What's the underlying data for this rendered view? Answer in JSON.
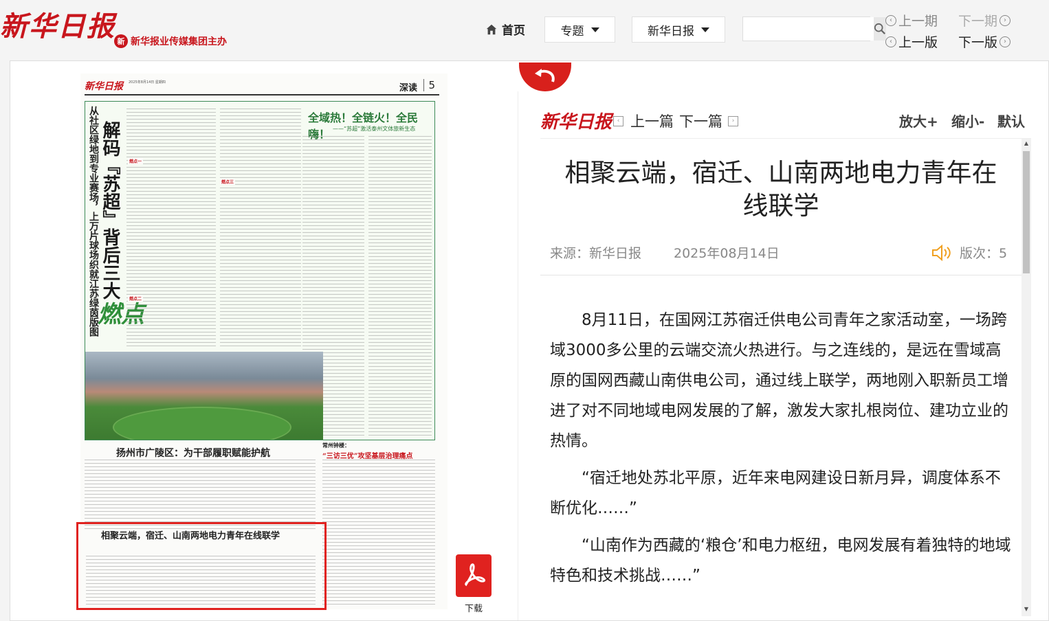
{
  "header": {
    "logo_text": "新华日报",
    "group_mark": "新",
    "group_text": "新华报业传媒集团主办",
    "home_label": "首页",
    "topics_label": "专题",
    "paper_label": "新华日报",
    "search_placeholder": "",
    "prev_issue": "上一期",
    "next_issue": "下一期",
    "prev_page": "上一版",
    "next_page": "下一版"
  },
  "newspaper": {
    "logo": "新华日报",
    "date_line": "2025年8月14日 星期四",
    "section": "深读",
    "page_number": "5",
    "green_vertical_small": "从社区绿地到专业赛场，上万片球场织就江苏绿茵版图",
    "green_vertical_big": "解码『苏超』背后三大",
    "green_burst": "燃点",
    "green_headline": "全域热！全链火！全民嗨！",
    "green_sub": "——“苏超”激活泰州文体旅新生态",
    "subhead_1": "燃点一",
    "subhead_2": "燃点二",
    "subhead_3": "燃点三",
    "headline_guangling": "扬州市广陵区：为干部履职赋能护航",
    "kicker_changzhou": "常州钟楼：",
    "headline_changzhou": "“三访三优”攻坚基层治理痛点",
    "selected_title": "相聚云端，宿迁、山南两地电力青年在线联学"
  },
  "download_label": "下载",
  "panel": {
    "logo": "新华日报",
    "prev_article": "上一篇",
    "next_article": "下一篇",
    "zoom_in": "放大+",
    "zoom_out": "缩小-",
    "zoom_default": "默认",
    "title": "相聚云端，宿迁、山南两地电力青年在线联学",
    "source": "来源：新华日报",
    "date": "2025年08月14日",
    "page_label": "版次：5",
    "paragraphs": [
      "8月11日，在国网江苏宿迁供电公司青年之家活动室，一场跨域3000多公里的云端交流火热进行。与之连线的，是远在雪域高原的国网西藏山南供电公司，通过线上联学，两地刚入职新员工增进了对不同地域电网发展的了解，激发大家扎根岗位、建功立业的热情。",
      "“宿迁地处苏北平原，近年来电网建设日新月异，调度体系不断优化……”",
      "“山南作为西藏的‘粮仓’和电力枢纽，电网发展有着独特的地域特色和技术挑战……”"
    ]
  },
  "colors": {
    "brand_red": "#c8161d",
    "highlight_red": "#e0221f",
    "green_accent": "#2b7a3a"
  },
  "icons": [
    "home-icon",
    "caret-down-icon",
    "search-icon",
    "circle-left-icon",
    "circle-right-icon",
    "back-arrow-icon",
    "pdf-icon",
    "square-left-icon",
    "square-right-icon",
    "speaker-icon"
  ]
}
